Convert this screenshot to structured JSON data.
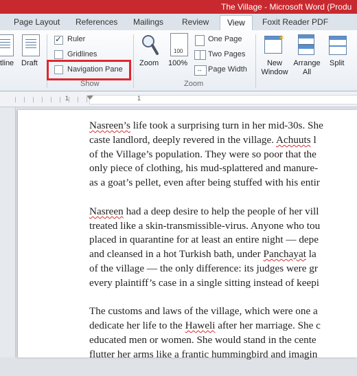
{
  "window": {
    "title": "The Village - Microsoft Word (Produ"
  },
  "tabs": [
    {
      "label": "Page Layout"
    },
    {
      "label": "References"
    },
    {
      "label": "Mailings"
    },
    {
      "label": "Review"
    },
    {
      "label": "View"
    },
    {
      "label": "Foxit Reader PDF"
    }
  ],
  "active_tab": "View",
  "ribbon": {
    "views": {
      "outline_label": "tline",
      "draft_label": "Draft"
    },
    "show": {
      "group_label": "Show",
      "ruler": {
        "label": "Ruler",
        "checked": true
      },
      "gridlines": {
        "label": "Gridlines",
        "checked": false
      },
      "navigation_pane": {
        "label": "Navigation Pane",
        "checked": false
      }
    },
    "zoom": {
      "group_label": "Zoom",
      "zoom_label": "Zoom",
      "hundred_label": "100%",
      "hundred_icon_text": "100",
      "one_page_label": "One Page",
      "two_pages_label": "Two Pages",
      "page_width_label": "Page Width"
    },
    "window": {
      "new_window_label": "New Window",
      "arrange_all_label": "Arrange All",
      "split_label": "Split"
    }
  },
  "ruler": {
    "numbers": [
      "1",
      "1"
    ]
  },
  "document": {
    "paragraphs": [
      [
        [
          {
            "t": "Nasreen’s",
            "sq": true
          },
          {
            "t": " life took a surprising turn in her mid-30s. She"
          }
        ],
        [
          {
            "t": "caste landlord, deeply revered in the village. "
          },
          {
            "t": "Achuuts",
            "sq": true
          },
          {
            "t": " l"
          }
        ],
        [
          {
            "t": "of the Village’s population. They were so poor that the"
          }
        ],
        [
          {
            "t": "only piece of clothing, his mud-splattered and manure-"
          }
        ],
        [
          {
            "t": "as a goat’s pellet, even after being stuffed with his entir"
          }
        ]
      ],
      [
        [
          {
            "t": "Nasreen",
            "sq": true
          },
          {
            "t": " had a deep desire to help the people of her vill"
          }
        ],
        [
          {
            "t": "treated like a skin-transmissible-virus. Anyone who tou"
          }
        ],
        [
          {
            "t": "placed in quarantine for at least an entire night — depe"
          }
        ],
        [
          {
            "t": "and cleansed in a hot Turkish bath, under "
          },
          {
            "t": "Panchayat",
            "sq": true
          },
          {
            "t": " la"
          }
        ],
        [
          {
            "t": "of the village — the only difference: its judges were gr"
          }
        ],
        [
          {
            "t": "every plaintiff’s case in a single sitting instead of keepi"
          }
        ]
      ],
      [
        [
          {
            "t": "The customs and laws of the village, which were one a"
          }
        ],
        [
          {
            "t": "dedicate her life to the "
          },
          {
            "t": "Haweli",
            "sq": true
          },
          {
            "t": " after her marriage. She c"
          }
        ],
        [
          {
            "t": "educated men or women. She would stand in the cente"
          }
        ],
        [
          {
            "t": "flutter her arms like a frantic hummingbird and imagin"
          }
        ]
      ]
    ]
  }
}
